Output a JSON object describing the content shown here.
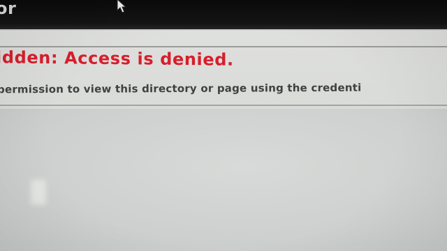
{
  "titlebar": {
    "title_fragment": "or"
  },
  "error": {
    "heading": "idden: Access is denied.",
    "detail": "permission to view this directory or page using the credenti"
  },
  "colors": {
    "heading": "#d81e2c",
    "detail": "#3f4140",
    "titlebar": "#0a0a0a",
    "page_background": "#d2d4d2"
  },
  "icons": {
    "cursor": "mouse-pointer-icon"
  }
}
